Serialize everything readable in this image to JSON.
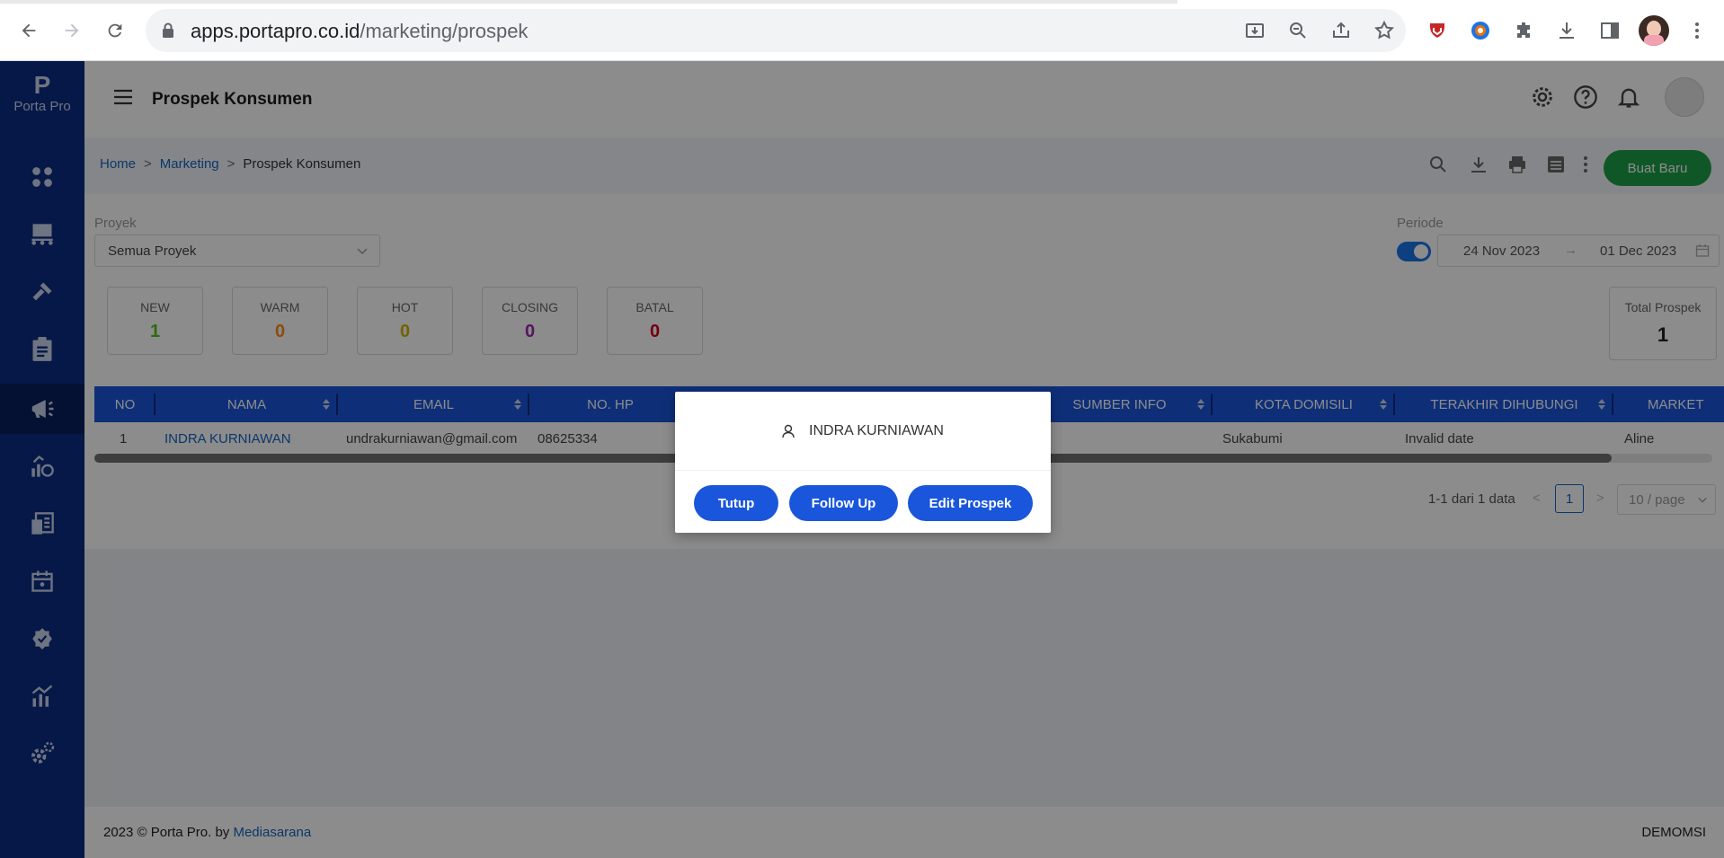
{
  "browser": {
    "url_host": "apps.portapro.co.id",
    "url_path": "/marketing/prospek"
  },
  "sidebar": {
    "logo_letter": "P",
    "logo_name": "Porta Pro",
    "items": [
      {
        "icon": "dashboard-icon"
      },
      {
        "icon": "network-icon"
      },
      {
        "icon": "hammer-icon"
      },
      {
        "icon": "clipboard-icon"
      },
      {
        "icon": "megaphone-icon",
        "active": true
      },
      {
        "icon": "finance-icon"
      },
      {
        "icon": "accounting-icon"
      },
      {
        "icon": "calendar-icon"
      },
      {
        "icon": "verified-icon"
      },
      {
        "icon": "report-chart-icon"
      },
      {
        "icon": "settings-gears-icon"
      }
    ]
  },
  "header": {
    "title": "Prospek Konsumen"
  },
  "breadcrumb": {
    "home": "Home",
    "separator": ">",
    "marketing": "Marketing",
    "current": "Prospek Konsumen"
  },
  "toolbar": {
    "new_button": "Buat Baru"
  },
  "filters": {
    "project_label": "Proyek",
    "project_value": "Semua Proyek",
    "period_label": "Periode",
    "date_start": "24 Nov 2023",
    "date_arrow": "→",
    "date_end": "01 Dec 2023"
  },
  "stats": {
    "new": {
      "label": "NEW",
      "value": "1",
      "color": "#52c41a"
    },
    "warm": {
      "label": "WARM",
      "value": "0",
      "color": "#fa8c16"
    },
    "hot": {
      "label": "HOT",
      "value": "0",
      "color": "#d4b106"
    },
    "closing": {
      "label": "CLOSING",
      "value": "0",
      "color": "#9c27b0"
    },
    "batal": {
      "label": "BATAL",
      "value": "0",
      "color": "#d0021b"
    },
    "total": {
      "label": "Total Prospek",
      "value": "1"
    }
  },
  "table": {
    "columns": [
      "NO",
      "NAMA",
      "EMAIL",
      "NO. HP",
      "SUMBER INFO",
      "KOTA DOMISILI",
      "TERAKHIR DIHUBUNGI",
      "MARKET"
    ],
    "rows": [
      {
        "no": "1",
        "nama": "INDRA KURNIAWAN",
        "email": "undrakurniawan@gmail.com",
        "hp": "08625334",
        "kota": "Sukabumi",
        "terakhir": "Invalid date",
        "marketing": "Aline"
      }
    ]
  },
  "pagination": {
    "summary": "1-1 dari 1 data",
    "prev": "<",
    "current": "1",
    "next": ">",
    "page_size": "10 / page"
  },
  "footer": {
    "copyright": "2023 © Porta Pro. by ",
    "company": "Mediasarana",
    "right_text": "DEMOMSI"
  },
  "modal": {
    "user_name": "INDRA KURNIAWAN",
    "close_button": "Tutup",
    "followup_button": "Follow Up",
    "edit_button": "Edit Prospek"
  },
  "colors": {
    "sidebar": "#0b2d82",
    "primary": "#1a56db",
    "success": "#1e9e4a"
  }
}
